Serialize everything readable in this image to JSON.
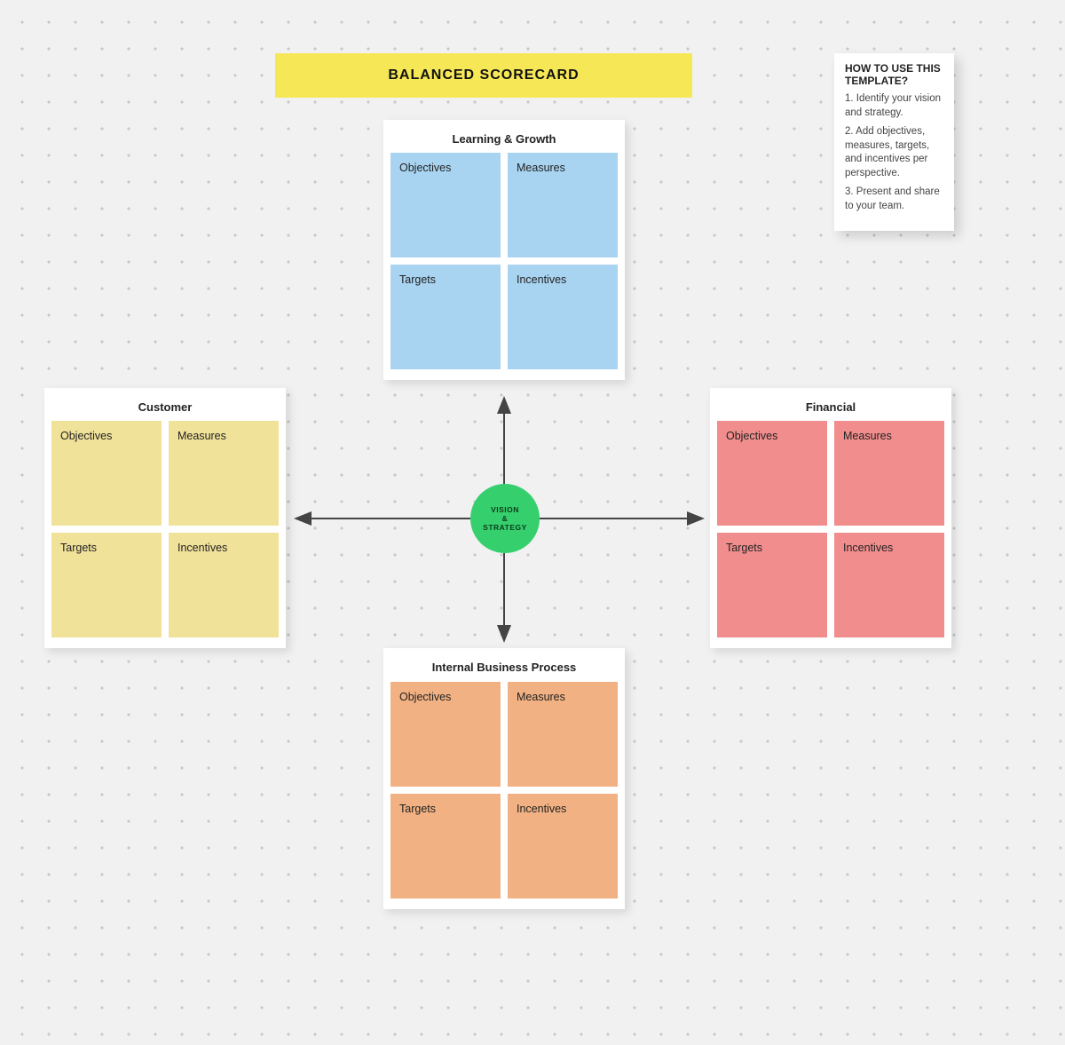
{
  "title": "BALANCED SCORECARD",
  "help": {
    "title": "HOW TO USE THIS TEMPLATE?",
    "steps": [
      "1. Identify your vision and strategy.",
      "2. Add objectives, measures, targets, and incentives per perspective.",
      "3. Present and share to your team."
    ]
  },
  "center": {
    "line1": "VISION",
    "line2": "&",
    "line3": "STRATEGY"
  },
  "panels": {
    "top": {
      "title": "Learning & Growth",
      "cells": [
        "Objectives",
        "Measures",
        "Targets",
        "Incentives"
      ],
      "color": "#a9d4f1"
    },
    "left": {
      "title": "Customer",
      "cells": [
        "Objectives",
        "Measures",
        "Targets",
        "Incentives"
      ],
      "color": "#f1e29a"
    },
    "right": {
      "title": "Financial",
      "cells": [
        "Objectives",
        "Measures",
        "Targets",
        "Incentives"
      ],
      "color": "#f28d8d"
    },
    "bottom": {
      "title": "Internal Business Process",
      "cells": [
        "Objectives",
        "Measures",
        "Targets",
        "Incentives"
      ],
      "color": "#f2b182"
    }
  }
}
